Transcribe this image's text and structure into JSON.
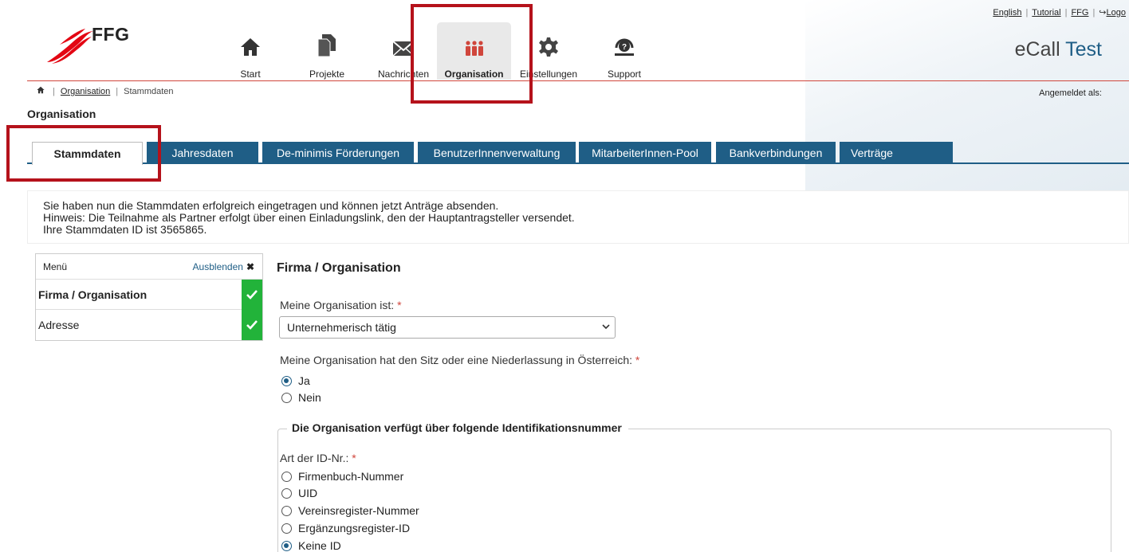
{
  "top_links": {
    "english": "English",
    "tutorial": "Tutorial",
    "ffg": "FFG",
    "logout": "Logo"
  },
  "logo": {
    "text": "FFG"
  },
  "nav": {
    "items": [
      {
        "label": "Start",
        "icon": "home-icon"
      },
      {
        "label": "Projekte",
        "icon": "documents-icon"
      },
      {
        "label": "Nachrichten",
        "icon": "envelope-icon"
      },
      {
        "label": "Organisation",
        "icon": "people-icon",
        "active": true
      },
      {
        "label": "Einstellungen",
        "icon": "gear-icon"
      },
      {
        "label": "Support",
        "icon": "support-icon"
      }
    ]
  },
  "brand": {
    "ecall": "eCall",
    "test": "Test"
  },
  "breadcrumb": {
    "home_icon": "home-icon",
    "item1": "Organisation",
    "item2": "Stammdaten"
  },
  "logged_in": "Angemeldet als:",
  "page_title": "Organisation",
  "tabs": [
    "Stammdaten",
    "Jahresdaten",
    "De-minimis Förderungen",
    "BenutzerInnenverwaltung",
    "MitarbeiterInnen-Pool",
    "Bankverbindungen",
    "Verträge"
  ],
  "info": {
    "line1": "Sie haben nun die Stammdaten erfolgreich eingetragen und können jetzt Anträge absenden.",
    "line2": "Hinweis: Die Teilnahme als Partner erfolgt über einen Einladungslink, den der Hauptantragsteller versendet.",
    "line3": "Ihre Stammdaten ID ist 3565865."
  },
  "menu": {
    "title": "Menü",
    "hide_label": "Ausblenden",
    "items": [
      {
        "label": "Firma / Organisation",
        "status": "complete"
      },
      {
        "label": "Adresse",
        "status": "complete"
      }
    ]
  },
  "form": {
    "title": "Firma / Organisation",
    "org_type_label": "Meine Organisation ist:",
    "org_type_value": "Unternehmerisch tätig",
    "seat_label": "Meine Organisation hat den Sitz oder eine Niederlassung in Österreich:",
    "seat_options": [
      "Ja",
      "Nein"
    ],
    "seat_selected": "Ja",
    "id_section_title": "Die Organisation verfügt über folgende Identifikationsnummer",
    "id_type_label": "Art der ID-Nr.:",
    "id_options": [
      "Firmenbuch-Nummer",
      "UID",
      "Vereinsregister-Nummer",
      "Ergänzungsregister-ID",
      "Keine ID"
    ],
    "id_selected": "Keine ID",
    "required_mark": "*"
  },
  "colors": {
    "brand_red": "#d0463c",
    "tab_blue": "#1f5e86",
    "check_green": "#22b33a",
    "highlight": "#b5121b"
  }
}
